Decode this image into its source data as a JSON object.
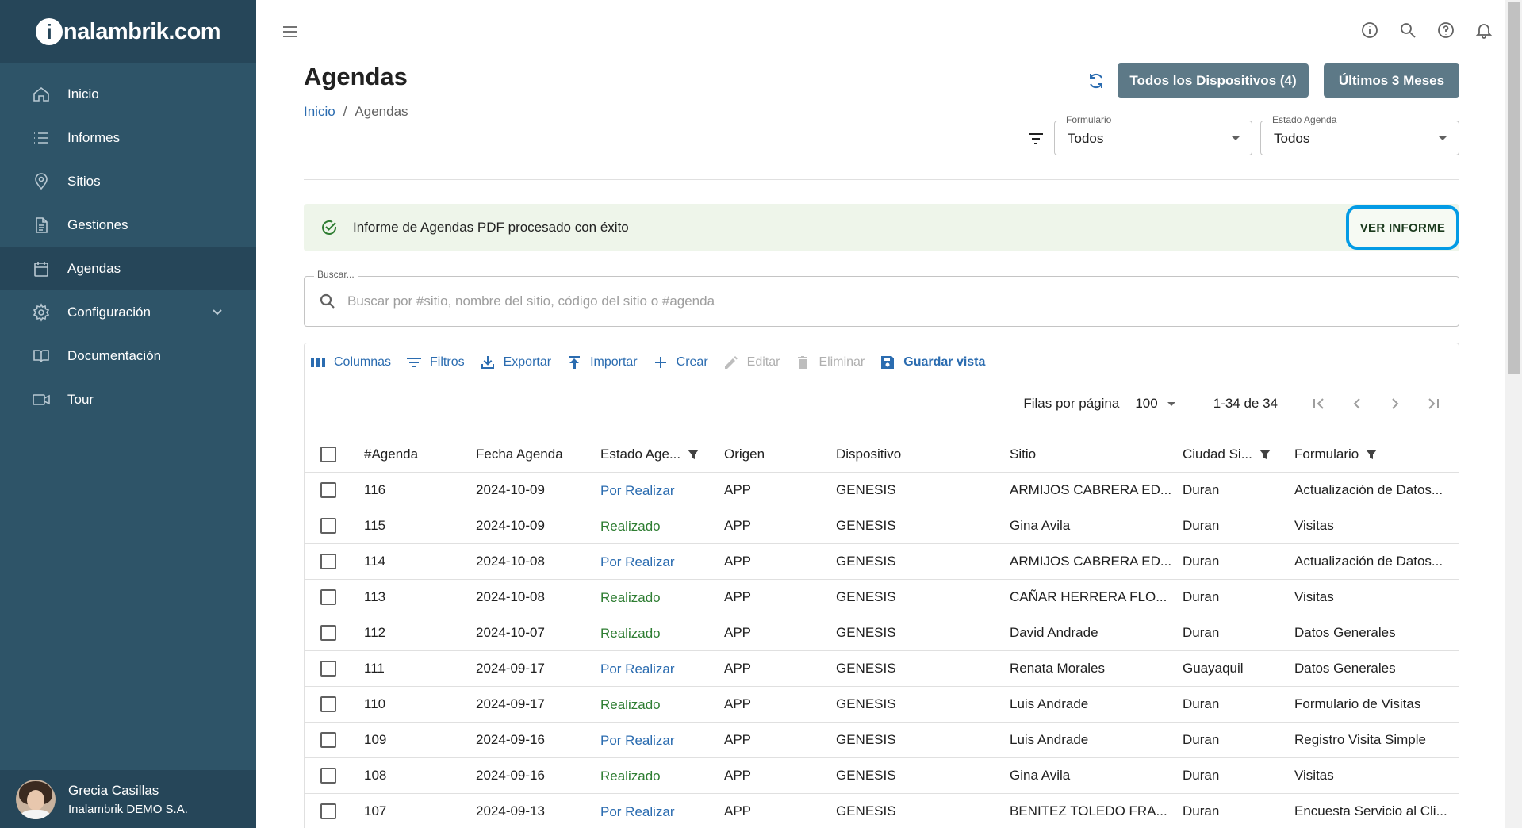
{
  "brand": {
    "logo_text": "nalambrik.com",
    "logo_mark": "i"
  },
  "sidebar": {
    "items": [
      {
        "label": "Inicio",
        "icon": "home-icon"
      },
      {
        "label": "Informes",
        "icon": "list-icon"
      },
      {
        "label": "Sitios",
        "icon": "location-pin-icon"
      },
      {
        "label": "Gestiones",
        "icon": "document-icon"
      },
      {
        "label": "Agendas",
        "icon": "calendar-icon",
        "active": true
      },
      {
        "label": "Configuración",
        "icon": "gear-icon"
      },
      {
        "label": "Documentación",
        "icon": "book-icon"
      },
      {
        "label": "Tour",
        "icon": "video-camera-icon"
      }
    ],
    "user": {
      "name": "Grecia Casillas",
      "company": "Inalambrik DEMO S.A."
    }
  },
  "page": {
    "title": "Agendas",
    "breadcrumb": {
      "home": "Inicio",
      "separator": "/",
      "current": "Agendas"
    },
    "devices_button": "Todos los Dispositivos (4)",
    "range_button": "Últimos 3 Meses",
    "filters": {
      "formulario": {
        "label": "Formulario",
        "value": "Todos"
      },
      "estado": {
        "label": "Estado Agenda",
        "value": "Todos"
      }
    }
  },
  "alert": {
    "text": "Informe de Agendas PDF procesado con éxito",
    "action": "VER INFORME"
  },
  "search": {
    "label": "Buscar...",
    "placeholder": "Buscar por #sitio, nombre del sitio, código del sitio o #agenda"
  },
  "toolbar": {
    "columns": "Columnas",
    "filters": "Filtros",
    "export": "Exportar",
    "import": "Importar",
    "create": "Crear",
    "edit": "Editar",
    "delete": "Eliminar",
    "save_view": "Guardar vista"
  },
  "pagination": {
    "rows_label": "Filas por página",
    "rows_value": "100",
    "range": "1-34 de 34"
  },
  "table": {
    "columns": {
      "agenda": "#Agenda",
      "fecha": "Fecha Agenda",
      "estado": "Estado Age...",
      "origen": "Origen",
      "dispositivo": "Dispositivo",
      "sitio": "Sitio",
      "ciudad": "Ciudad Si...",
      "formulario": "Formulario"
    },
    "rows": [
      {
        "agenda": "116",
        "fecha": "2024-10-09",
        "estado": "Por Realizar",
        "origen": "APP",
        "dispositivo": "GENESIS",
        "sitio": "ARMIJOS CABRERA ED...",
        "ciudad": "Duran",
        "formulario": "Actualización de Datos..."
      },
      {
        "agenda": "115",
        "fecha": "2024-10-09",
        "estado": "Realizado",
        "origen": "APP",
        "dispositivo": "GENESIS",
        "sitio": "Gina Avila",
        "ciudad": "Duran",
        "formulario": "Visitas"
      },
      {
        "agenda": "114",
        "fecha": "2024-10-08",
        "estado": "Por Realizar",
        "origen": "APP",
        "dispositivo": "GENESIS",
        "sitio": "ARMIJOS CABRERA ED...",
        "ciudad": "Duran",
        "formulario": "Actualización de Datos..."
      },
      {
        "agenda": "113",
        "fecha": "2024-10-08",
        "estado": "Realizado",
        "origen": "APP",
        "dispositivo": "GENESIS",
        "sitio": "CAÑAR HERRERA FLO...",
        "ciudad": "Duran",
        "formulario": "Visitas"
      },
      {
        "agenda": "112",
        "fecha": "2024-10-07",
        "estado": "Realizado",
        "origen": "APP",
        "dispositivo": "GENESIS",
        "sitio": "David Andrade",
        "ciudad": "Duran",
        "formulario": "Datos Generales"
      },
      {
        "agenda": "111",
        "fecha": "2024-09-17",
        "estado": "Por Realizar",
        "origen": "APP",
        "dispositivo": "GENESIS",
        "sitio": "Renata Morales",
        "ciudad": "Guayaquil",
        "formulario": "Datos Generales"
      },
      {
        "agenda": "110",
        "fecha": "2024-09-17",
        "estado": "Realizado",
        "origen": "APP",
        "dispositivo": "GENESIS",
        "sitio": "Luis Andrade",
        "ciudad": "Duran",
        "formulario": "Formulario de Visitas"
      },
      {
        "agenda": "109",
        "fecha": "2024-09-16",
        "estado": "Por Realizar",
        "origen": "APP",
        "dispositivo": "GENESIS",
        "sitio": "Luis Andrade",
        "ciudad": "Duran",
        "formulario": "Registro Visita Simple"
      },
      {
        "agenda": "108",
        "fecha": "2024-09-16",
        "estado": "Realizado",
        "origen": "APP",
        "dispositivo": "GENESIS",
        "sitio": "Gina Avila",
        "ciudad": "Duran",
        "formulario": "Visitas"
      },
      {
        "agenda": "107",
        "fecha": "2024-09-13",
        "estado": "Por Realizar",
        "origen": "APP",
        "dispositivo": "GENESIS",
        "sitio": "BENITEZ TOLEDO FRA...",
        "ciudad": "Duran",
        "formulario": "Encuesta Servicio al Cli..."
      }
    ]
  },
  "colors": {
    "sidebar": "#2e5468",
    "sidebar_dark": "#264659",
    "primary": "#2b6cb0",
    "success": "#2e7d32",
    "highlight": "#039be5"
  }
}
